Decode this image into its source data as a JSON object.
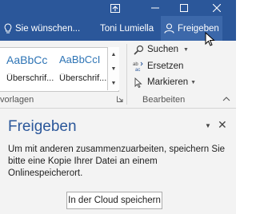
{
  "titlebar": {
    "icons": [
      "ribbon-display-options-icon",
      "minimize-icon",
      "maximize-icon",
      "close-icon"
    ]
  },
  "ribbon_bar": {
    "tell_me": "Sie wünschen...",
    "user": "Toni Lumiella",
    "share": "Freigeben",
    "accent_color": "#2b579a"
  },
  "styles": {
    "items": [
      {
        "preview": "AaBbCc",
        "label": "Überschrif..."
      },
      {
        "preview": "AaBbCcI",
        "label": "Überschrif..."
      }
    ],
    "group_label": "vorlagen"
  },
  "editing": {
    "search": "Suchen",
    "replace": "Ersetzen",
    "select": "Markieren",
    "group_label": "Bearbeiten"
  },
  "share_pane": {
    "title": "Freigeben",
    "message": "Um mit anderen zusammenzuarbeiten, speichern Sie bitte eine Kopie Ihrer Datei an einem Onlinespeicherort.",
    "button": "In der Cloud speichern"
  }
}
